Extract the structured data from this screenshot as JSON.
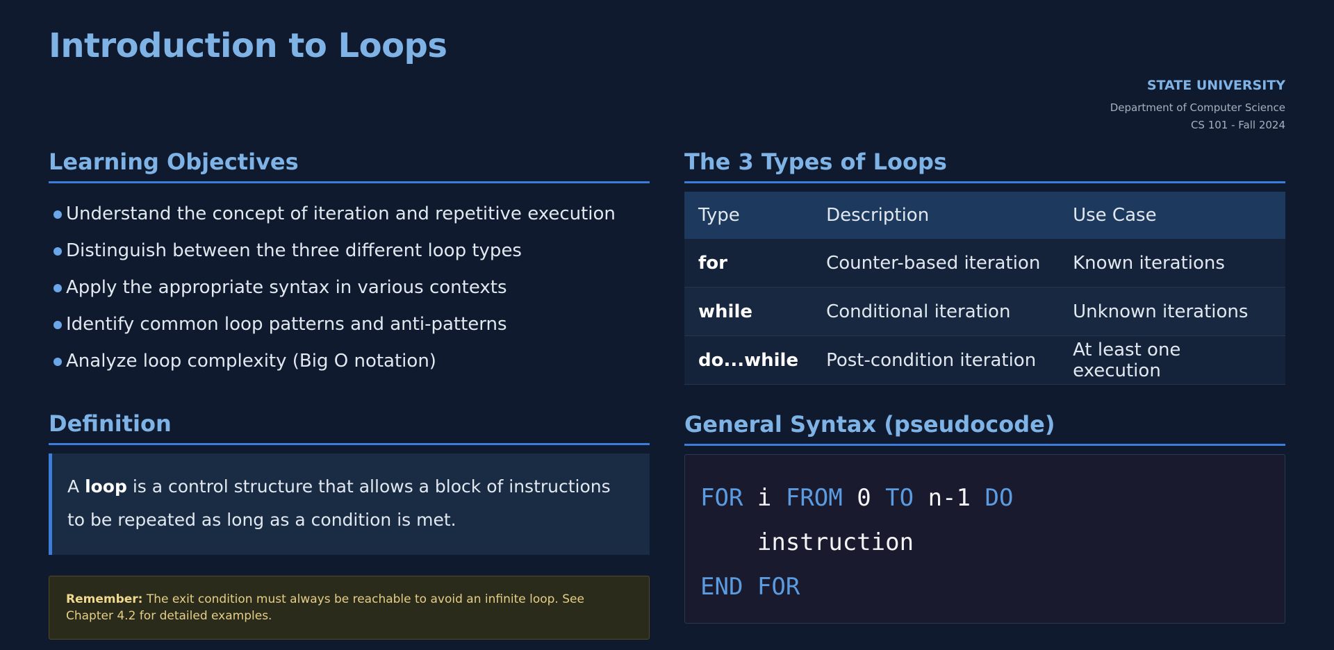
{
  "page": {
    "title": "Introduction to Loops"
  },
  "institution": {
    "name": "STATE UNIVERSITY",
    "department": "Department of Computer Science",
    "course": "CS 101 - Fall 2024"
  },
  "objectives": {
    "heading": "Learning Objectives",
    "items": [
      "Understand the concept of iteration and repetitive execution",
      "Distinguish between the three different loop types",
      "Apply the appropriate syntax in various contexts",
      "Identify common loop patterns and anti-patterns",
      "Analyze loop complexity (Big O notation)"
    ]
  },
  "definition": {
    "heading": "Definition",
    "prefix": "A ",
    "term": "loop",
    "text": " is a control structure that allows a block of instructions to be repeated as long as a condition is met."
  },
  "callout": {
    "label": "Remember:",
    "text": " The exit condition must always be reachable to avoid an infinite loop. See Chapter 4.2 for detailed examples."
  },
  "loop_types": {
    "heading": "The 3 Types of Loops",
    "columns": [
      "Type",
      "Description",
      "Use Case"
    ],
    "rows": [
      {
        "type": "for",
        "description": "Counter-based iteration",
        "use_case": "Known iterations"
      },
      {
        "type": "while",
        "description": "Conditional iteration",
        "use_case": "Unknown iterations"
      },
      {
        "type": "do...while",
        "description": "Post-condition iteration",
        "use_case": "At least one execution"
      }
    ]
  },
  "syntax": {
    "heading": "General Syntax (pseudocode)",
    "line1": {
      "k1": "FOR",
      "t1": " i ",
      "k2": "FROM",
      "t2": " 0 ",
      "k3": "TO",
      "t3": " n-1 ",
      "k4": "DO"
    },
    "line2": "    instruction",
    "line3": {
      "k1": "END",
      "t1": " ",
      "k2": "FOR"
    }
  },
  "colors": {
    "background": "#0f1a2e",
    "accent": "#3b7dd8",
    "heading": "#7fb3e6",
    "callout_text": "#e5cf86",
    "code_keyword": "#5b9be0"
  }
}
